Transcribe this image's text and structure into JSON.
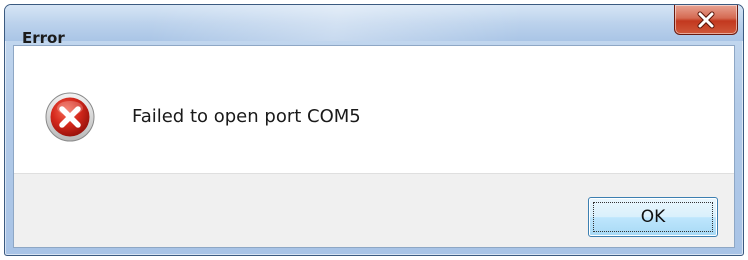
{
  "dialog": {
    "title": "Error",
    "message": "Failed to open port COM5",
    "icon": "error-icon",
    "close_icon": "close-icon",
    "ok_label": "OK"
  },
  "colors": {
    "error_red": "#c8211a",
    "close_red": "#c2381f",
    "titlebar_blue": "#bcd2ec",
    "button_border": "#3c7fb1"
  }
}
